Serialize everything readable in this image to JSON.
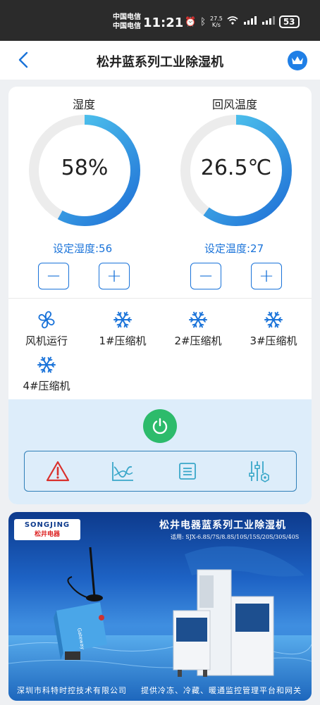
{
  "status_bar": {
    "carrier_1": "中国电信",
    "carrier_2": "中国电信",
    "time": "11:21",
    "speed_value": "27.5",
    "speed_unit": "K/s",
    "battery": "53"
  },
  "header": {
    "title": "松井蓝系列工业除湿机"
  },
  "gauges": [
    {
      "label": "湿度",
      "value": "58%",
      "fraction": 0.58,
      "setpoint_label": "设定湿度:56"
    },
    {
      "label": "回风温度",
      "value": "26.5℃",
      "fraction": 0.6,
      "setpoint_label": "设定温度:27"
    }
  ],
  "buttons": {
    "minus": "−",
    "plus": "+"
  },
  "devices": [
    {
      "label": "风机运行",
      "icon": "fan-icon"
    },
    {
      "label": "1#压缩机",
      "icon": "snowflake-icon"
    },
    {
      "label": "2#压缩机",
      "icon": "snowflake-icon"
    },
    {
      "label": "3#压缩机",
      "icon": "snowflake-icon"
    },
    {
      "label": "4#压缩机",
      "icon": "snowflake-icon"
    }
  ],
  "toolbar": [
    "alarm-icon",
    "chart-icon",
    "list-icon",
    "settings-sliders-icon"
  ],
  "banner": {
    "logo_top": "SONGJING",
    "logo_bottom": "松井电器",
    "title": "松井电器蓝系列工业除湿机",
    "subtitle": "适用: SJX-6.8S/7S/8.8S/10S/15S/20S/30S/40S",
    "footer_left": "深圳市科特时控技术有限公司",
    "footer_right": "提供冷冻、冷藏、暖通监控管理平台和网关",
    "gateway_label": "Gateway"
  },
  "colors": {
    "accent": "#1a73d9",
    "gauge_start": "#1f6fd6",
    "gauge_end": "#59d6f2",
    "gauge_track": "#ececec",
    "power": "#2dbb6b",
    "alarm": "#d9302c",
    "control_panel": "#ddedfa"
  }
}
